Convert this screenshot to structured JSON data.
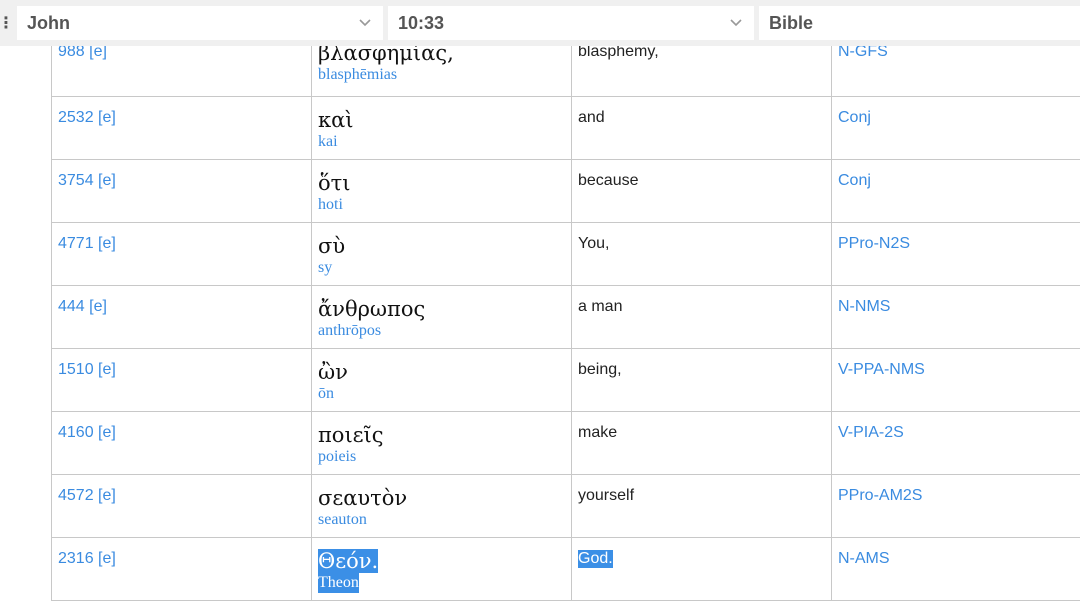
{
  "nav": {
    "book": "John",
    "chapter_verse": "10:33",
    "version": "Bible"
  },
  "rows": [
    {
      "strongs": "988 [e]",
      "greek": "βλασφημίας,",
      "translit": "blasphēmias",
      "english": "blasphemy,",
      "parse": "N-GFS"
    },
    {
      "strongs": "2532 [e]",
      "greek": "καὶ",
      "translit": "kai",
      "english": "and",
      "parse": "Conj"
    },
    {
      "strongs": "3754 [e]",
      "greek": "ὅτι",
      "translit": "hoti",
      "english": "because",
      "parse": "Conj"
    },
    {
      "strongs": "4771 [e]",
      "greek": "σὺ",
      "translit": "sy",
      "english": "You,",
      "parse": "PPro-N2S"
    },
    {
      "strongs": "444 [e]",
      "greek": "ἄνθρωπος",
      "translit": "anthrōpos",
      "english": "a man",
      "parse": "N-NMS"
    },
    {
      "strongs": "1510 [e]",
      "greek": "ὢν",
      "translit": "ōn",
      "english": "being,",
      "parse": "V-PPA-NMS"
    },
    {
      "strongs": "4160 [e]",
      "greek": "ποιεῖς",
      "translit": "poieis",
      "english": "make",
      "parse": "V-PIA-2S"
    },
    {
      "strongs": "4572 [e]",
      "greek": "σεαυτὸν",
      "translit": "seauton",
      "english": "yourself",
      "parse": "PPro-AM2S"
    },
    {
      "strongs": "2316 [e]",
      "greek": "Θεόν.",
      "translit": "Theon",
      "english": "God.",
      "parse": "N-AMS"
    }
  ],
  "colors": {
    "link": "#3a8be0",
    "selection": "#3b8fe6",
    "border": "#c8c8c8",
    "topbar": "#f0f0f0"
  },
  "icons": {
    "menu": "kebab-menu-icon",
    "dropdown": "chevron-down-icon"
  }
}
